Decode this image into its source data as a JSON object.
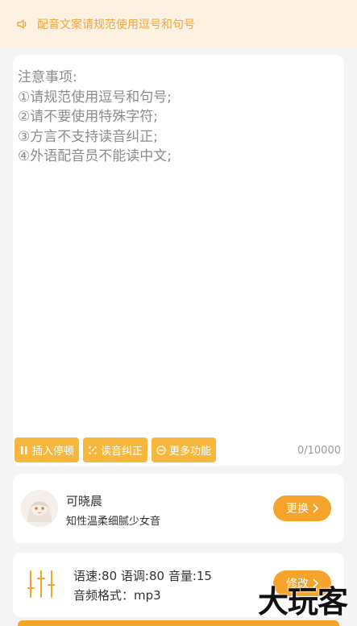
{
  "notice": {
    "icon": "speaker-icon",
    "text": "配音文案请规范使用逗号和句号"
  },
  "editor": {
    "placeholder_lines": "注意事项:\n①请规范使用逗号和句号;\n②请不要使用特殊字符;\n③方言不支持读音纠正;\n④外语配音员不能读中文;",
    "counter": "0/10000",
    "tools": [
      {
        "label": "插入停顿",
        "icon": "pause-icon"
      },
      {
        "label": "读音纠正",
        "icon": "correct-icon"
      },
      {
        "label": "更多功能",
        "icon": "more-icon"
      }
    ]
  },
  "voice": {
    "name": "可晓晨",
    "description": "知性温柔细腻少女音",
    "button": "更换"
  },
  "params": {
    "line1": "语速:80 语调:80 音量:15",
    "line2": "音频格式：mp3",
    "button": "修改"
  },
  "watermark": "大玩客",
  "colors": {
    "accent": "#f6a32b",
    "notice_bg": "#fdf2e2",
    "notice_text": "#f3a43a"
  }
}
